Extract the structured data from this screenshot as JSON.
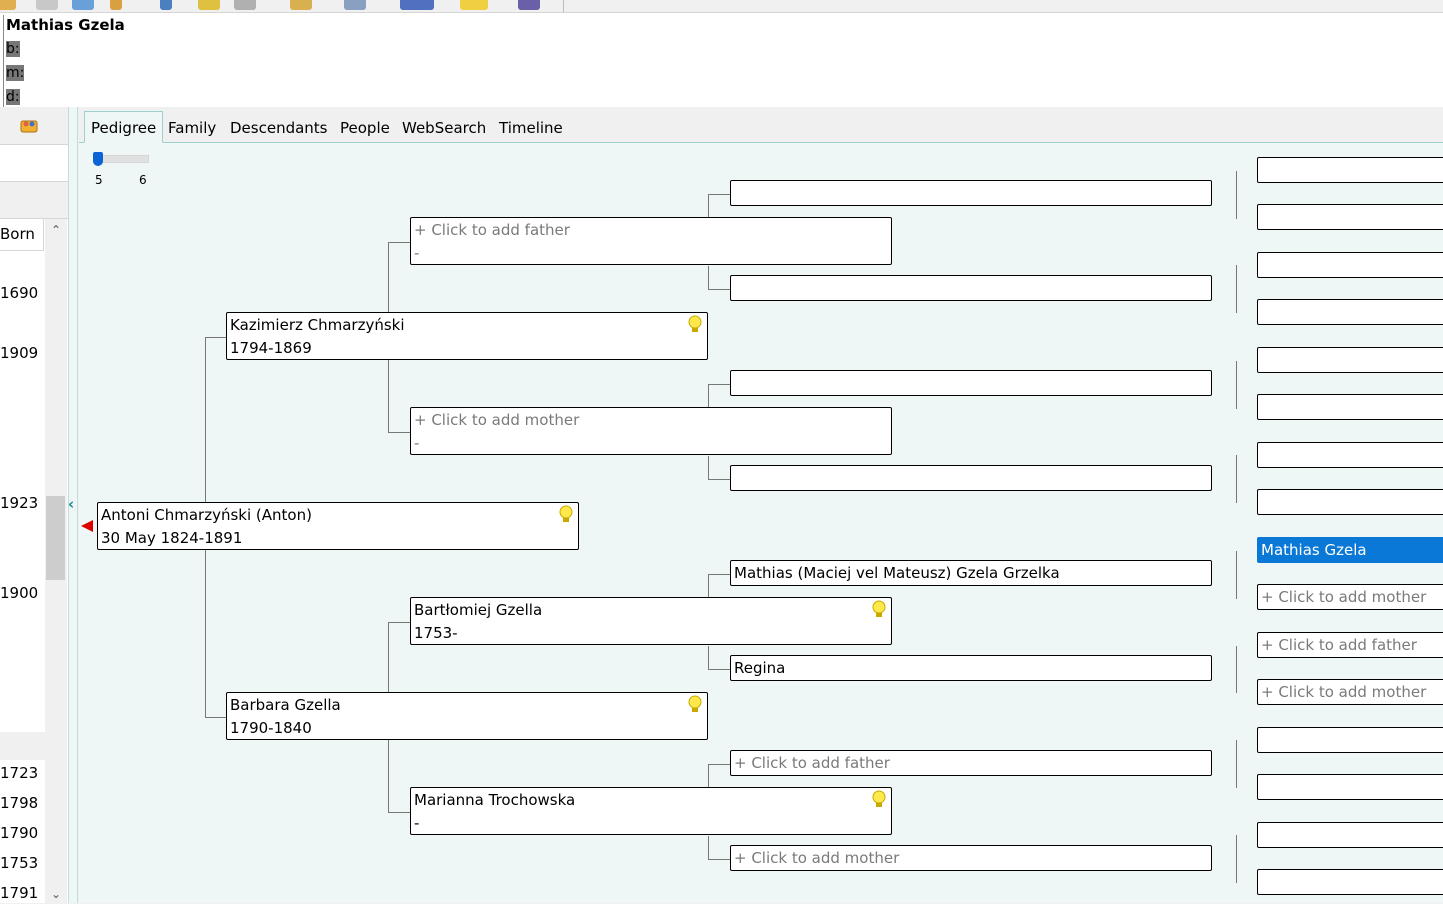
{
  "header": {
    "name": "Mathias Gzela",
    "born_label": "b:",
    "married_label": "m:",
    "died_label": "d:"
  },
  "left_panel": {
    "column_header": "Born",
    "years": [
      "1690",
      "1909",
      "1923",
      "1900",
      "1723",
      "1798",
      "1790",
      "1753",
      "1791"
    ]
  },
  "tabs": [
    "Pedigree",
    "Family",
    "Descendants",
    "People",
    "WebSearch",
    "Timeline"
  ],
  "active_tab": "Pedigree",
  "generations_slider": {
    "min_label": "5",
    "max_label": "6",
    "value": 5
  },
  "pedigree": {
    "root": {
      "name": "Antoni Chmarzyński (Anton)",
      "dates": "30 May 1824-1891"
    },
    "father": {
      "name": "Kazimierz Chmarzyński",
      "dates": "1794-1869"
    },
    "mother": {
      "name": "Barbara Gzella",
      "dates": "1790-1840"
    },
    "ff_placeholder": {
      "label": "+ Click to add father",
      "dates": "-"
    },
    "fm_placeholder": {
      "label": "+ Click to add mother",
      "dates": "-"
    },
    "mf": {
      "name": "Bartłomiej Gzella",
      "dates": "1753-"
    },
    "mm": {
      "name": "Marianna Trochowska",
      "dates": "-"
    },
    "mff": {
      "name": "Mathias (Maciej vel Mateusz) Gzela Grzelka"
    },
    "mfm": {
      "name": "Regina"
    },
    "mmf_placeholder": "+ Click to add father",
    "mmm_placeholder": "+ Click to add mother",
    "g5_selected": "Mathias Gzela",
    "g5_add_mother_1": "+ Click to add mother",
    "g5_add_father": "+ Click to add father",
    "g5_add_mother_2": "+ Click to add mother"
  },
  "colors": {
    "selected": "#0a78d7",
    "panel_bg": "#eff6f6",
    "accent": "#1a8a8a"
  }
}
